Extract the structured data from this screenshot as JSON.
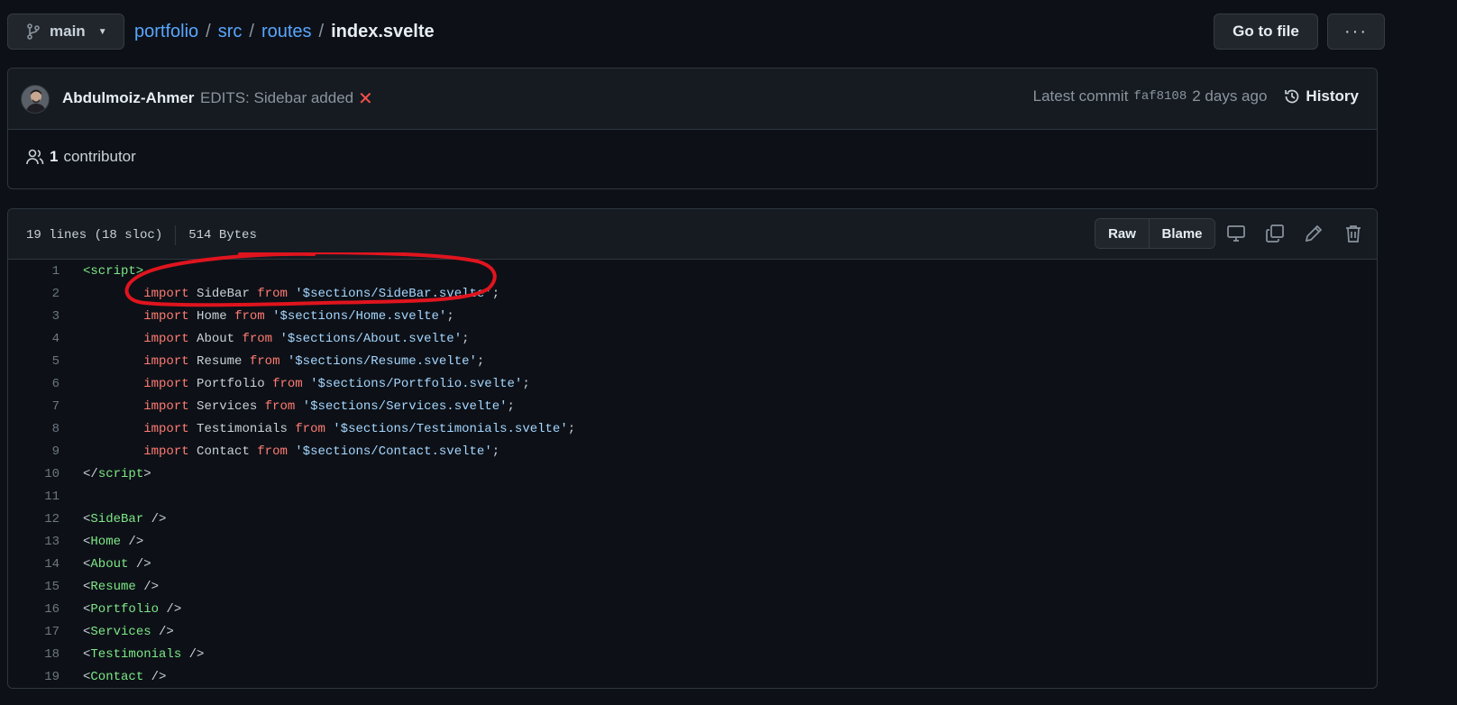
{
  "branch": {
    "name": "main"
  },
  "breadcrumb": {
    "repo": "portfolio",
    "dir1": "src",
    "dir2": "routes",
    "file": "index.svelte",
    "sep": "/"
  },
  "toolbar": {
    "goto_label": "Go to file",
    "more_label": "···"
  },
  "commit": {
    "author": "Abdulmoiz-Ahmer",
    "message": "EDITS: Sidebar added",
    "status_icon": "close-icon",
    "latest_label": "Latest commit",
    "sha": "faf8108",
    "time": "2 days ago",
    "history_label": "History"
  },
  "contributors": {
    "count": "1",
    "label": "contributor"
  },
  "file": {
    "lines_info": "19 lines (18 sloc)",
    "size": "514 Bytes",
    "raw_label": "Raw",
    "blame_label": "Blame"
  },
  "code_lines": [
    {
      "n": "1",
      "parts": [
        [
          "tag",
          "<script>"
        ]
      ]
    },
    {
      "n": "2",
      "parts": [
        [
          "pl",
          "\t"
        ],
        [
          "kw",
          "import"
        ],
        [
          "pl",
          " SideBar "
        ],
        [
          "kw",
          "from"
        ],
        [
          "pl",
          " "
        ],
        [
          "str",
          "'$sections/SideBar.svelte'"
        ],
        [
          "pl",
          ";"
        ]
      ]
    },
    {
      "n": "3",
      "parts": [
        [
          "pl",
          "\t"
        ],
        [
          "kw",
          "import"
        ],
        [
          "pl",
          " Home "
        ],
        [
          "kw",
          "from"
        ],
        [
          "pl",
          " "
        ],
        [
          "str",
          "'$sections/Home.svelte'"
        ],
        [
          "pl",
          ";"
        ]
      ]
    },
    {
      "n": "4",
      "parts": [
        [
          "pl",
          "\t"
        ],
        [
          "kw",
          "import"
        ],
        [
          "pl",
          " About "
        ],
        [
          "kw",
          "from"
        ],
        [
          "pl",
          " "
        ],
        [
          "str",
          "'$sections/About.svelte'"
        ],
        [
          "pl",
          ";"
        ]
      ]
    },
    {
      "n": "5",
      "parts": [
        [
          "pl",
          "\t"
        ],
        [
          "kw",
          "import"
        ],
        [
          "pl",
          " Resume "
        ],
        [
          "kw",
          "from"
        ],
        [
          "pl",
          " "
        ],
        [
          "str",
          "'$sections/Resume.svelte'"
        ],
        [
          "pl",
          ";"
        ]
      ]
    },
    {
      "n": "6",
      "parts": [
        [
          "pl",
          "\t"
        ],
        [
          "kw",
          "import"
        ],
        [
          "pl",
          " Portfolio "
        ],
        [
          "kw",
          "from"
        ],
        [
          "pl",
          " "
        ],
        [
          "str",
          "'$sections/Portfolio.svelte'"
        ],
        [
          "pl",
          ";"
        ]
      ]
    },
    {
      "n": "7",
      "parts": [
        [
          "pl",
          "\t"
        ],
        [
          "kw",
          "import"
        ],
        [
          "pl",
          " Services "
        ],
        [
          "kw",
          "from"
        ],
        [
          "pl",
          " "
        ],
        [
          "str",
          "'$sections/Services.svelte'"
        ],
        [
          "pl",
          ";"
        ]
      ]
    },
    {
      "n": "8",
      "parts": [
        [
          "pl",
          "\t"
        ],
        [
          "kw",
          "import"
        ],
        [
          "pl",
          " Testimonials "
        ],
        [
          "kw",
          "from"
        ],
        [
          "pl",
          " "
        ],
        [
          "str",
          "'$sections/Testimonials.svelte'"
        ],
        [
          "pl",
          ";"
        ]
      ]
    },
    {
      "n": "9",
      "parts": [
        [
          "pl",
          "\t"
        ],
        [
          "kw",
          "import"
        ],
        [
          "pl",
          " Contact "
        ],
        [
          "kw",
          "from"
        ],
        [
          "pl",
          " "
        ],
        [
          "str",
          "'$sections/Contact.svelte'"
        ],
        [
          "pl",
          ";"
        ]
      ]
    },
    {
      "n": "10",
      "parts": [
        [
          "pl",
          "</"
        ],
        [
          "tag",
          "script"
        ],
        [
          "pl",
          ">"
        ]
      ]
    },
    {
      "n": "11",
      "parts": []
    },
    {
      "n": "12",
      "parts": [
        [
          "pl",
          "<"
        ],
        [
          "tag",
          "SideBar"
        ],
        [
          "pl",
          " />"
        ]
      ]
    },
    {
      "n": "13",
      "parts": [
        [
          "pl",
          "<"
        ],
        [
          "tag",
          "Home"
        ],
        [
          "pl",
          " />"
        ]
      ]
    },
    {
      "n": "14",
      "parts": [
        [
          "pl",
          "<"
        ],
        [
          "tag",
          "About"
        ],
        [
          "pl",
          " />"
        ]
      ]
    },
    {
      "n": "15",
      "parts": [
        [
          "pl",
          "<"
        ],
        [
          "tag",
          "Resume"
        ],
        [
          "pl",
          " />"
        ]
      ]
    },
    {
      "n": "16",
      "parts": [
        [
          "pl",
          "<"
        ],
        [
          "tag",
          "Portfolio"
        ],
        [
          "pl",
          " />"
        ]
      ]
    },
    {
      "n": "17",
      "parts": [
        [
          "pl",
          "<"
        ],
        [
          "tag",
          "Services"
        ],
        [
          "pl",
          " />"
        ]
      ]
    },
    {
      "n": "18",
      "parts": [
        [
          "pl",
          "<"
        ],
        [
          "tag",
          "Testimonials"
        ],
        [
          "pl",
          " />"
        ]
      ]
    },
    {
      "n": "19",
      "parts": [
        [
          "pl",
          "<"
        ],
        [
          "tag",
          "Contact"
        ],
        [
          "pl",
          " />"
        ]
      ]
    }
  ],
  "colors": {
    "keyword": "#ff7b72",
    "string": "#a5d6ff",
    "tag": "#7ee787",
    "link": "#58a6ff",
    "annotation": "#e0141e"
  }
}
